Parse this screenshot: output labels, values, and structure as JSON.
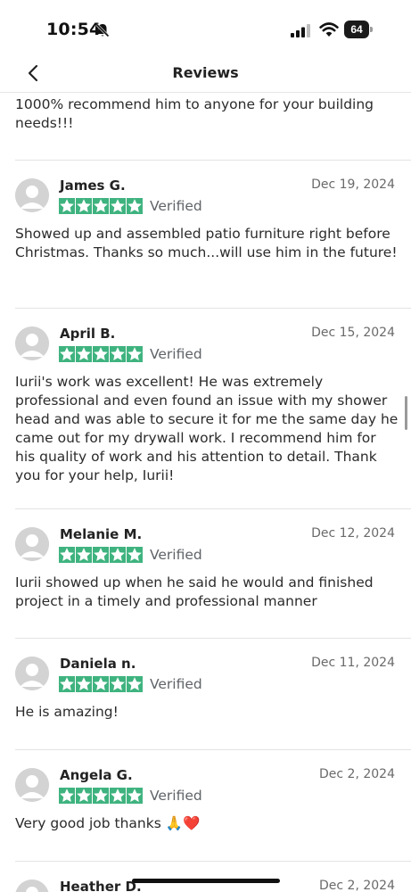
{
  "status_bar": {
    "time": "10:54",
    "battery_level": "64"
  },
  "nav": {
    "title": "Reviews"
  },
  "intro_text": "1000% recommend him to anyone for your building needs!!!",
  "verified_label": "Verified",
  "rating_stars": 5,
  "reviews": [
    {
      "name": "James G.",
      "date": "Dec 19, 2024",
      "text": "Showed up and assembled patio furniture right before Christmas. Thanks so much...will use him in the future!"
    },
    {
      "name": "April B.",
      "date": "Dec 15, 2024",
      "text": "Iurii's work was excellent! He was extremely professional and even found an issue with my shower head and was able to secure it for me the same day he came out for my drywall work. I recommend him for his quality of work and his attention to detail. Thank you for your help, Iurii!"
    },
    {
      "name": "Melanie M.",
      "date": "Dec 12, 2024",
      "text": "Iurii showed up when he said he would and finished project in a timely and professional manner"
    },
    {
      "name": "Daniela n.",
      "date": "Dec 11, 2024",
      "text": "He is amazing!"
    },
    {
      "name": "Angela G.",
      "date": "Dec 2, 2024",
      "text": "Very good job thanks 🙏❤️"
    },
    {
      "name": "Heather D.",
      "date": "Dec 2, 2024",
      "text": ""
    }
  ],
  "colors": {
    "star": "#3fb37f",
    "avatar": "#d3d3d3",
    "divider": "#e3e3e3"
  }
}
